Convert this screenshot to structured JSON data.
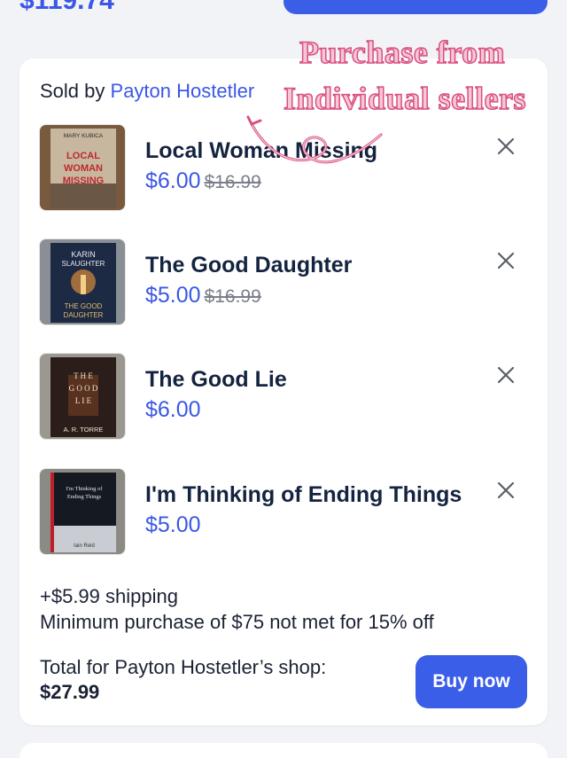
{
  "header": {
    "price_partial": "$119.74"
  },
  "seller": {
    "prefix": "Sold by",
    "name": "Payton Hostetler"
  },
  "items": [
    {
      "title": "Local Woman Missing",
      "price": "$6.00",
      "old_price": "$16.99",
      "cover": {
        "author": "MARY KUBICA",
        "title": "LOCAL WOMAN MISSING",
        "bg": "#c8b79f",
        "fg": "#c0272d"
      }
    },
    {
      "title": "The Good Daughter",
      "price": "$5.00",
      "old_price": "$16.99",
      "cover": {
        "author": "KARIN SLAUGHTER",
        "title": "THE GOOD DAUGHTER",
        "bg": "#1d2a44",
        "fg": "#e8b96a"
      }
    },
    {
      "title": "The Good Lie",
      "price": "$6.00",
      "old_price": "",
      "cover": {
        "author": "A. R. TORRE",
        "title": "THE GOOD LIE",
        "bg": "#2b1e1a",
        "fg": "#efe4d0"
      }
    },
    {
      "title": "I'm Thinking of Ending Things",
      "price": "$5.00",
      "old_price": "",
      "cover": {
        "author": "Iain Reid",
        "title": "I'm Thinking of Ending Things",
        "bg": "#151a22",
        "fg": "#e6e6e6"
      }
    }
  ],
  "shipping": {
    "line1": "+$5.99 shipping",
    "line2": "Minimum purchase of $75 not met for 15% off"
  },
  "total": {
    "label": "Total for Payton Hostetler’s shop:",
    "value": "$27.99"
  },
  "buy_button": {
    "label": "Buy now"
  },
  "annotation": {
    "line1": "Purchase from",
    "line2": "Individual sellers"
  },
  "colors": {
    "accent": "#3a5ee8",
    "annotation": "#d9517f"
  }
}
